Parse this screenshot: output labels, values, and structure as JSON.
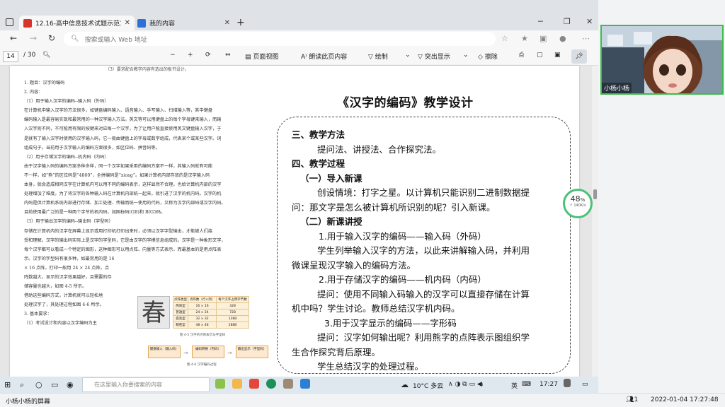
{
  "browser": {
    "tabs": [
      {
        "label": "12.16-高中信息技术试题示范1-0",
        "active": true
      },
      {
        "label": "我的内容",
        "active": false
      }
    ],
    "address_placeholder": "搜索或输入 Web 地址"
  },
  "pdf_toolbar": {
    "page_current": "14",
    "page_total": "/ 30",
    "page_view": "页面视图",
    "read_aloud": "朗读此页内容",
    "draw": "绘制",
    "highlight": "突出显示",
    "erase": "擦除"
  },
  "doc_left": {
    "cut_line": "（3）要求配合教学内容有选出的板书设计。",
    "lines": [
      "1. 题目：汉字的编码",
      "2. 内容：",
      "（1）用于输入汉字的编码--输入码（外码）",
      "在计算机中输入汉字的方法很多，如键盘编码输入、语音输入、手写输入、扫描输入等，其中键盘",
      "编码输入是最容易实现和最常用的一种汉字输入方法。英文等可以用键盘上的每个字母键来输入，而输",
      "入汉字则不同，不可能用有限的按键来对应每一个汉字，为了让用户能直接使用英文键盘输入汉字，于",
      "是就有了输入汉字时使用的汉字输入码，它一般由键盘上的字母或数字组成，代表某个或某些汉字。词",
      "组成句子。当前用于汉字输入的编码方案很多，如区位码、拼音码等。",
      "（2）用于存储汉字的编码--机内码（内码）",
      "由于汉字输入码的编码方案多种多样，同一个汉字如果采用的编码方案不一样，其输入码就有可能",
      "不一样，如“熊”的区位码是“4860”，全拼编码是“xiong”。如果计算机内部存放的是汉字输入码",
      "本身，就会造成相同汉字在计算机内可以用不同的编码表示，这样显然不合理。也给计算机内部的汉字",
      "处理增加了难度。为了将汉字的各种输入码在计算机内部统一起来，就引进了汉字的机内码。汉字的机",
      "内码是供计算机系统内部进行存储、加工处理、传输而统一使用的代码，又称为汉字内部码或汉字内码。",
      "目前使用最广泛的是一种两个字节的机内码，如国标码(GB)和 BIG5码。",
      "（3）用于输出汉字的编码--输出码（字型码）",
      "存储在计算机内的汉字在屏幕上显示或用打印机打印出来时，必须以汉字字型输出，才能被人们接",
      "受和理解。汉字的输出码实际上是汉字的字型码，它是由汉字的字模信息组成的。汉字是一种象形文字，",
      "每个汉字都可以看成一个特定的图形，这种图形可以用点阵、向量等方式表示，而最基本的是用点阵表",
      "示。汉字的字型码有很多种，如最常用的是 16",
      "× 16 点阵，打印一般用 24 × 24 点阵，点",
      "阵数越大，显示的汉字效果越好，且需要的存",
      "储容量也越大，如图 4-5 所示。",
      "借助这些编码方式，计算机就可以轻松地",
      "处理汉字了，其处理过程如图 4-6 所示。",
      "3. 基本要求：",
      "（1）考试设计和内容以汉字编码为主"
    ],
    "figure_char": "春",
    "figure_table": {
      "headers": [
        "点阵类型",
        "点阵数（行×列）",
        "每个汉字占用字节数"
      ],
      "rows": [
        [
          "简易型",
          "16 × 16",
          "32B"
        ],
        [
          "普通型",
          "24 × 24",
          "72B"
        ],
        [
          "提高型",
          "32 × 32",
          "128B"
        ],
        [
          "精密型",
          "48 × 48",
          "288B"
        ]
      ]
    },
    "figure_caption_1": "图 4-5 汉字的点阵表示与字型码",
    "figure_caption_2": "图 4-6 汉字编码过程",
    "flow": [
      "键盘输入（输入码）",
      "编码转换（内码）",
      "输出显示（字型码）"
    ]
  },
  "doc_right": {
    "title": "《汉字的编码》教学设计",
    "lines": [
      {
        "text": "三、教学方法",
        "style": "h"
      },
      {
        "text": "提问法、讲授法、合作探究法。",
        "style": "ind1"
      },
      {
        "text": "四、教学过程",
        "style": "h"
      },
      {
        "text": "（一）导入新课",
        "style": "h ind2"
      },
      {
        "text": "创设情境：打字之星。以计算机只能识别二进制数据提",
        "style": "ind1"
      },
      {
        "text": "问：那文字是怎么被计算机所识别的呢？引入新课。",
        "style": ""
      },
      {
        "text": "（二）新课讲授",
        "style": "h ind2"
      },
      {
        "text": "1.用于输入汉字的编码——输入码（外码）",
        "style": "ind3"
      },
      {
        "text": "学生列举输入汉字的方法，以此来讲解输入码，并利用",
        "style": "ind1"
      },
      {
        "text": "微课呈现汉字输入的编码方法。",
        "style": ""
      },
      {
        "text": "2.用于存储汉字的编码——机内码（内码）",
        "style": "ind3"
      },
      {
        "text": "提问：使用不同输入码输入的汉字可以直接存储在计算",
        "style": "ind1"
      },
      {
        "text": "机中吗？学生讨论。教师总结汉字机内码。",
        "style": ""
      },
      {
        "text": "3.用于汉字显示的编码——字形码",
        "style": "ind4"
      },
      {
        "text": "提问：汉字如何输出呢？利用熊字的点阵表示图组织学",
        "style": "ind1"
      },
      {
        "text": "生合作探究背后原理。",
        "style": ""
      },
      {
        "text": "学生总结汉字的处理过程。",
        "style": "ind1"
      }
    ]
  },
  "meter": {
    "percent": "48",
    "unit": "%",
    "speed": "140K/s"
  },
  "taskbar": {
    "search_placeholder": "在这里输入你要搜索的内容",
    "weather": "10°C 多云",
    "lang": "英",
    "time": "17:27"
  },
  "camera": {
    "name": "小杨小杨"
  },
  "bottom": {
    "screen_label": "小杨小杨的屏幕",
    "participants": "1",
    "datetime": "2022-01-04 17:27:48"
  },
  "colors": {
    "accent_green": "#3fba4c",
    "meter_green": "#4cc07a"
  }
}
